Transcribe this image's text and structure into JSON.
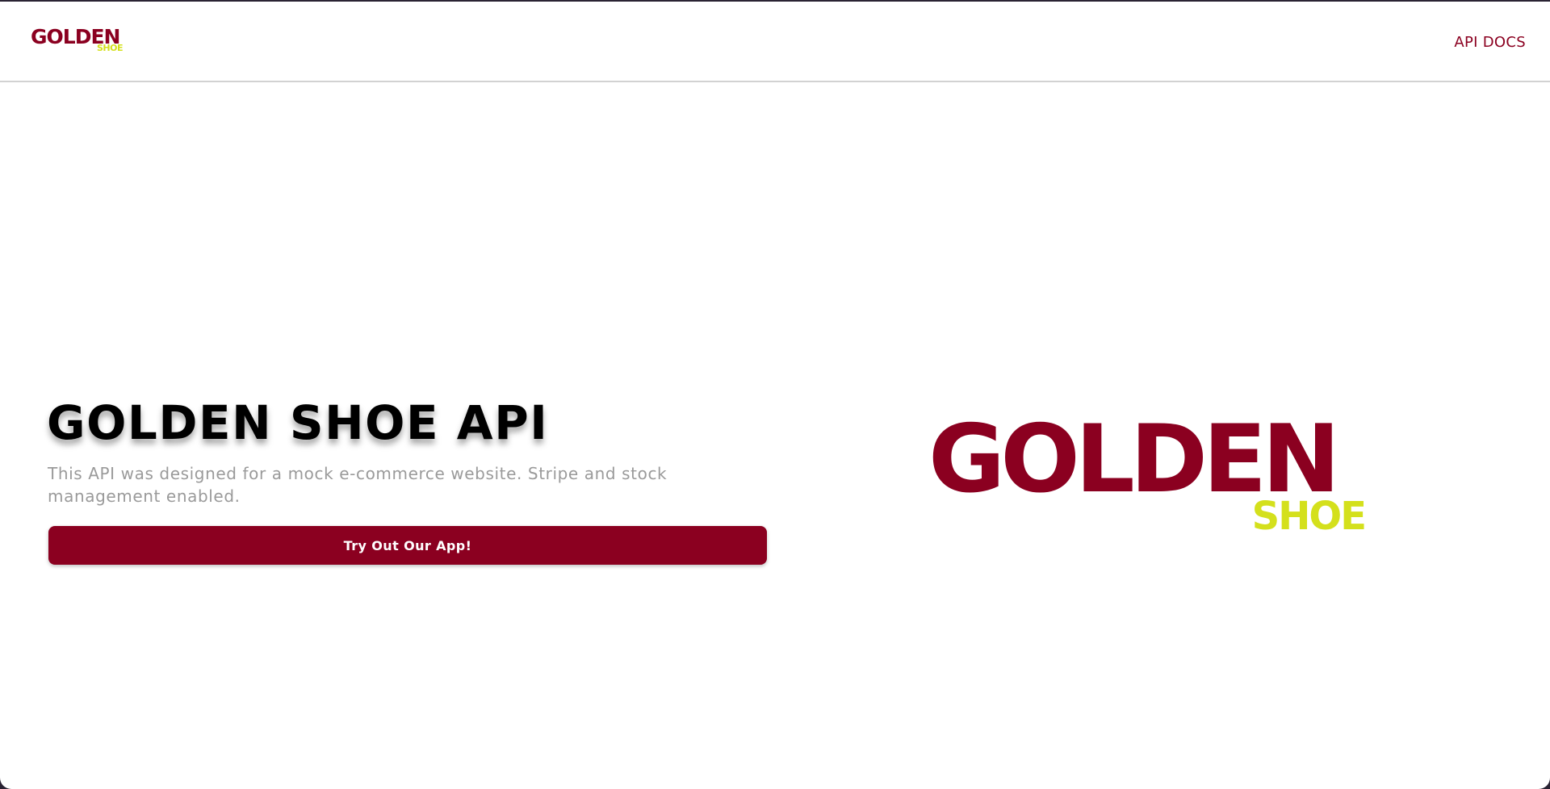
{
  "navbar": {
    "logo": {
      "main": "GOLDEN",
      "sub": "SHOE"
    },
    "links": [
      {
        "label": "API DOCS"
      }
    ]
  },
  "hero": {
    "title": "GOLDEN SHOE API",
    "description": "This API was designed for a mock e-commerce website. Stripe and stock management enabled.",
    "cta_label": "Try Out Our App!",
    "logo": {
      "main": "GOLDEN",
      "sub": "SHOE"
    }
  },
  "colors": {
    "brand_primary": "#8b0020",
    "brand_accent": "#d4e01c",
    "text_muted": "#9a9a9a",
    "background": "#ffffff"
  }
}
